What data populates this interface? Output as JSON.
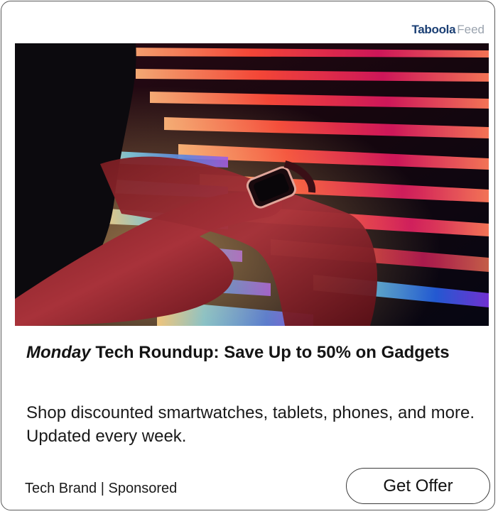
{
  "brand": {
    "part1": "Taboola",
    "part2": "Feed"
  },
  "ad": {
    "title_italic": "Monday",
    "title_rest": " Tech Roundup: Save Up to 50% on Gadgets",
    "description": "Shop discounted smartwatches, tablets, phones, and more. Updated every week.",
    "advertiser": "Tech Brand",
    "separator": " | ",
    "sponsored_label": "Sponsored",
    "cta_label": "Get Offer"
  },
  "image": {
    "subject": "hand-tapping-smartwatch-against-neon-light-wall"
  }
}
